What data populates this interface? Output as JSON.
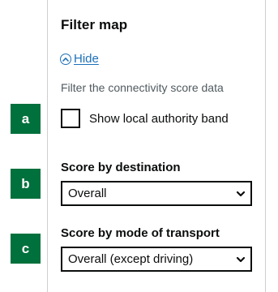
{
  "panel": {
    "title": "Filter map",
    "hide_label": "Hide",
    "hint": "Filter the connectivity score data",
    "checkbox": {
      "label": "Show local authority band",
      "checked": false
    },
    "destination": {
      "label": "Score by destination",
      "selected": "Overall"
    },
    "mode": {
      "label": "Score by mode of transport",
      "selected": "Overall (except driving)"
    }
  },
  "badges": {
    "a": "a",
    "b": "b",
    "c": "c"
  },
  "colors": {
    "link": "#1d70b8",
    "badge": "#00703c",
    "text": "#0b0c0c",
    "hint": "#505a5f"
  },
  "icons": {
    "hide": "chevron-up-circle-icon",
    "select": "chevron-down-icon"
  }
}
